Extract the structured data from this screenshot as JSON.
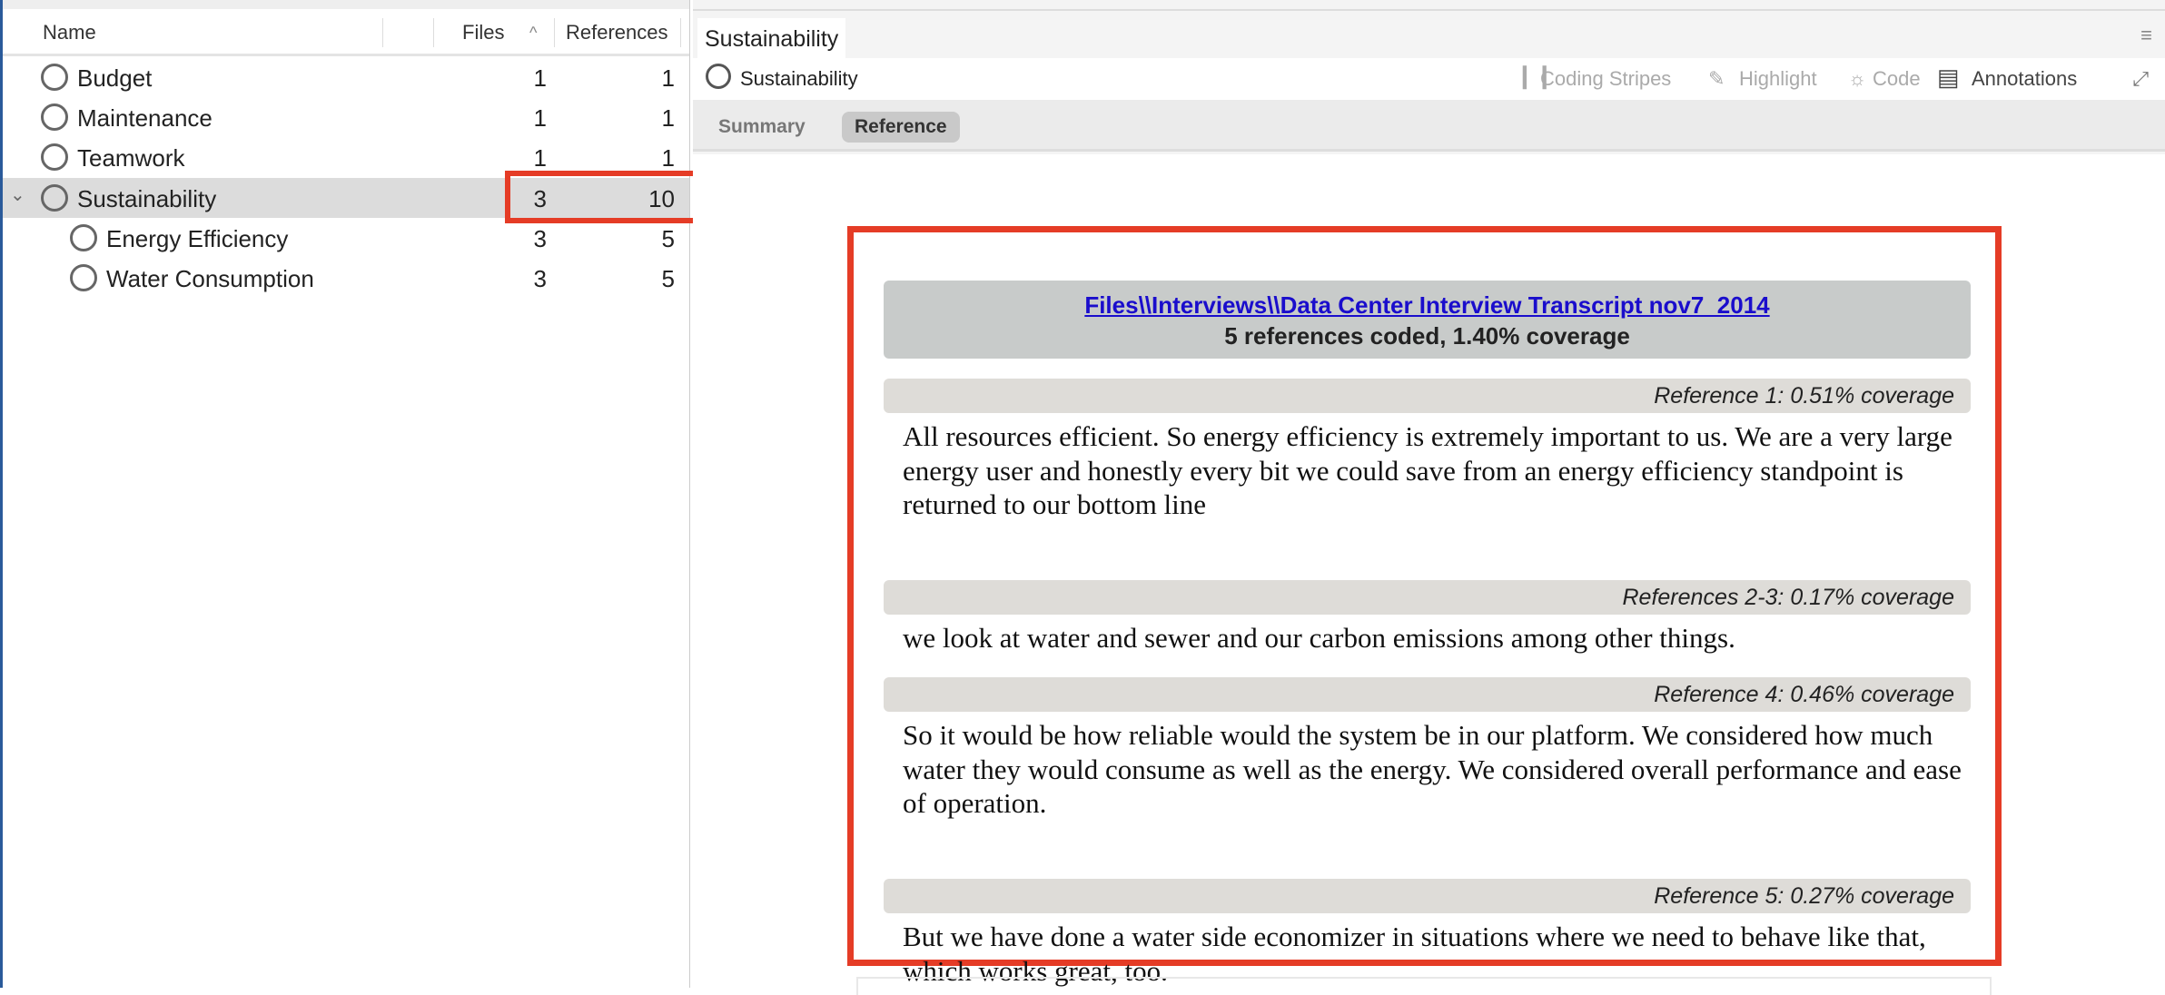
{
  "nodes_panel": {
    "columns": {
      "name": "Name",
      "files": "Files",
      "references": "References",
      "sort_indicator": "^"
    },
    "rows": [
      {
        "name": "Budget",
        "files": "1",
        "references": "1"
      },
      {
        "name": "Maintenance",
        "files": "1",
        "references": "1"
      },
      {
        "name": "Teamwork",
        "files": "1",
        "references": "1"
      },
      {
        "name": "Sustainability",
        "files": "3",
        "references": "10",
        "expanded": true,
        "selected": true
      },
      {
        "name": "Energy Efficiency",
        "files": "3",
        "references": "5"
      },
      {
        "name": "Water Consumption",
        "files": "3",
        "references": "5"
      }
    ]
  },
  "detail": {
    "tab_title": "Sustainability",
    "node_title": "Sustainability",
    "toolbar": {
      "coding_stripes": "Coding Stripes",
      "highlight": "Highlight",
      "code": "Code",
      "annotations": "Annotations"
    },
    "view_tabs": {
      "summary": "Summary",
      "reference": "Reference",
      "active": "Reference"
    },
    "source": {
      "link": "Files\\\\Interviews\\\\Data Center Interview Transcript nov7_2014",
      "summary": "5 references coded, 1.40% coverage"
    },
    "references": [
      {
        "label": "Reference 1: 0.51% coverage",
        "text": "All resources efficient. So energy efficiency is extremely important to us. We are a very large energy user and honestly every bit we could save from an energy efficiency standpoint is returned to our bottom line"
      },
      {
        "label": "References 2-3: 0.17% coverage",
        "text": "we look at water and sewer and our carbon emissions among other things."
      },
      {
        "label": "Reference 4: 0.46% coverage",
        "text": "So it would be how reliable would the system be in our platform. We considered how much water they would consume as well as the energy. We considered overall performance and ease of operation."
      },
      {
        "label": "Reference 5: 0.27% coverage",
        "text": "But we have done a water side economizer in situations where we need to behave like that, which works great, too."
      }
    ]
  },
  "colors": {
    "highlight_box": "#e53c26",
    "link": "#1a0dcc",
    "selected_row": "#dcdcdc"
  }
}
